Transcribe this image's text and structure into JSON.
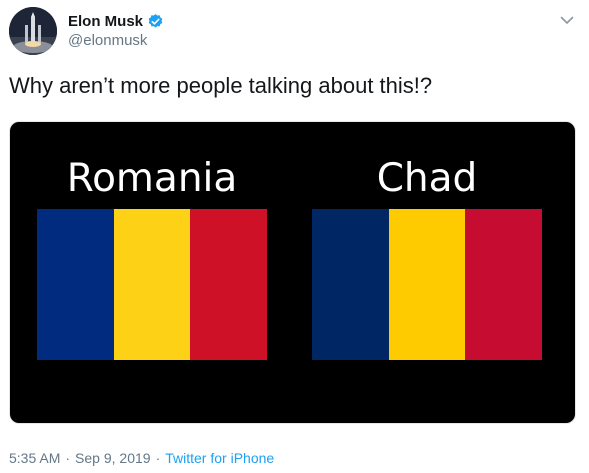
{
  "author": {
    "name": "Elon Musk",
    "handle": "@elonmusk",
    "verified": true,
    "avatar_icon": "rocket-launch-avatar-icon"
  },
  "menu_icon": "chevron-down-icon",
  "tweet": {
    "text": "Why aren’t more people talking about this!?"
  },
  "media": {
    "background": "#000000",
    "flags": [
      {
        "label": "Romania",
        "stripes": [
          "#002b7f",
          "#fcd116",
          "#ce1126"
        ]
      },
      {
        "label": "Chad",
        "stripes": [
          "#002664",
          "#fecb00",
          "#c60c30"
        ]
      }
    ]
  },
  "footer": {
    "time": "5:35 AM",
    "separator": "·",
    "date": "Sep 9, 2019",
    "source": "Twitter for iPhone"
  },
  "colors": {
    "verified_badge": "#1da1f2",
    "link": "#1da1f2",
    "muted": "#657786"
  }
}
